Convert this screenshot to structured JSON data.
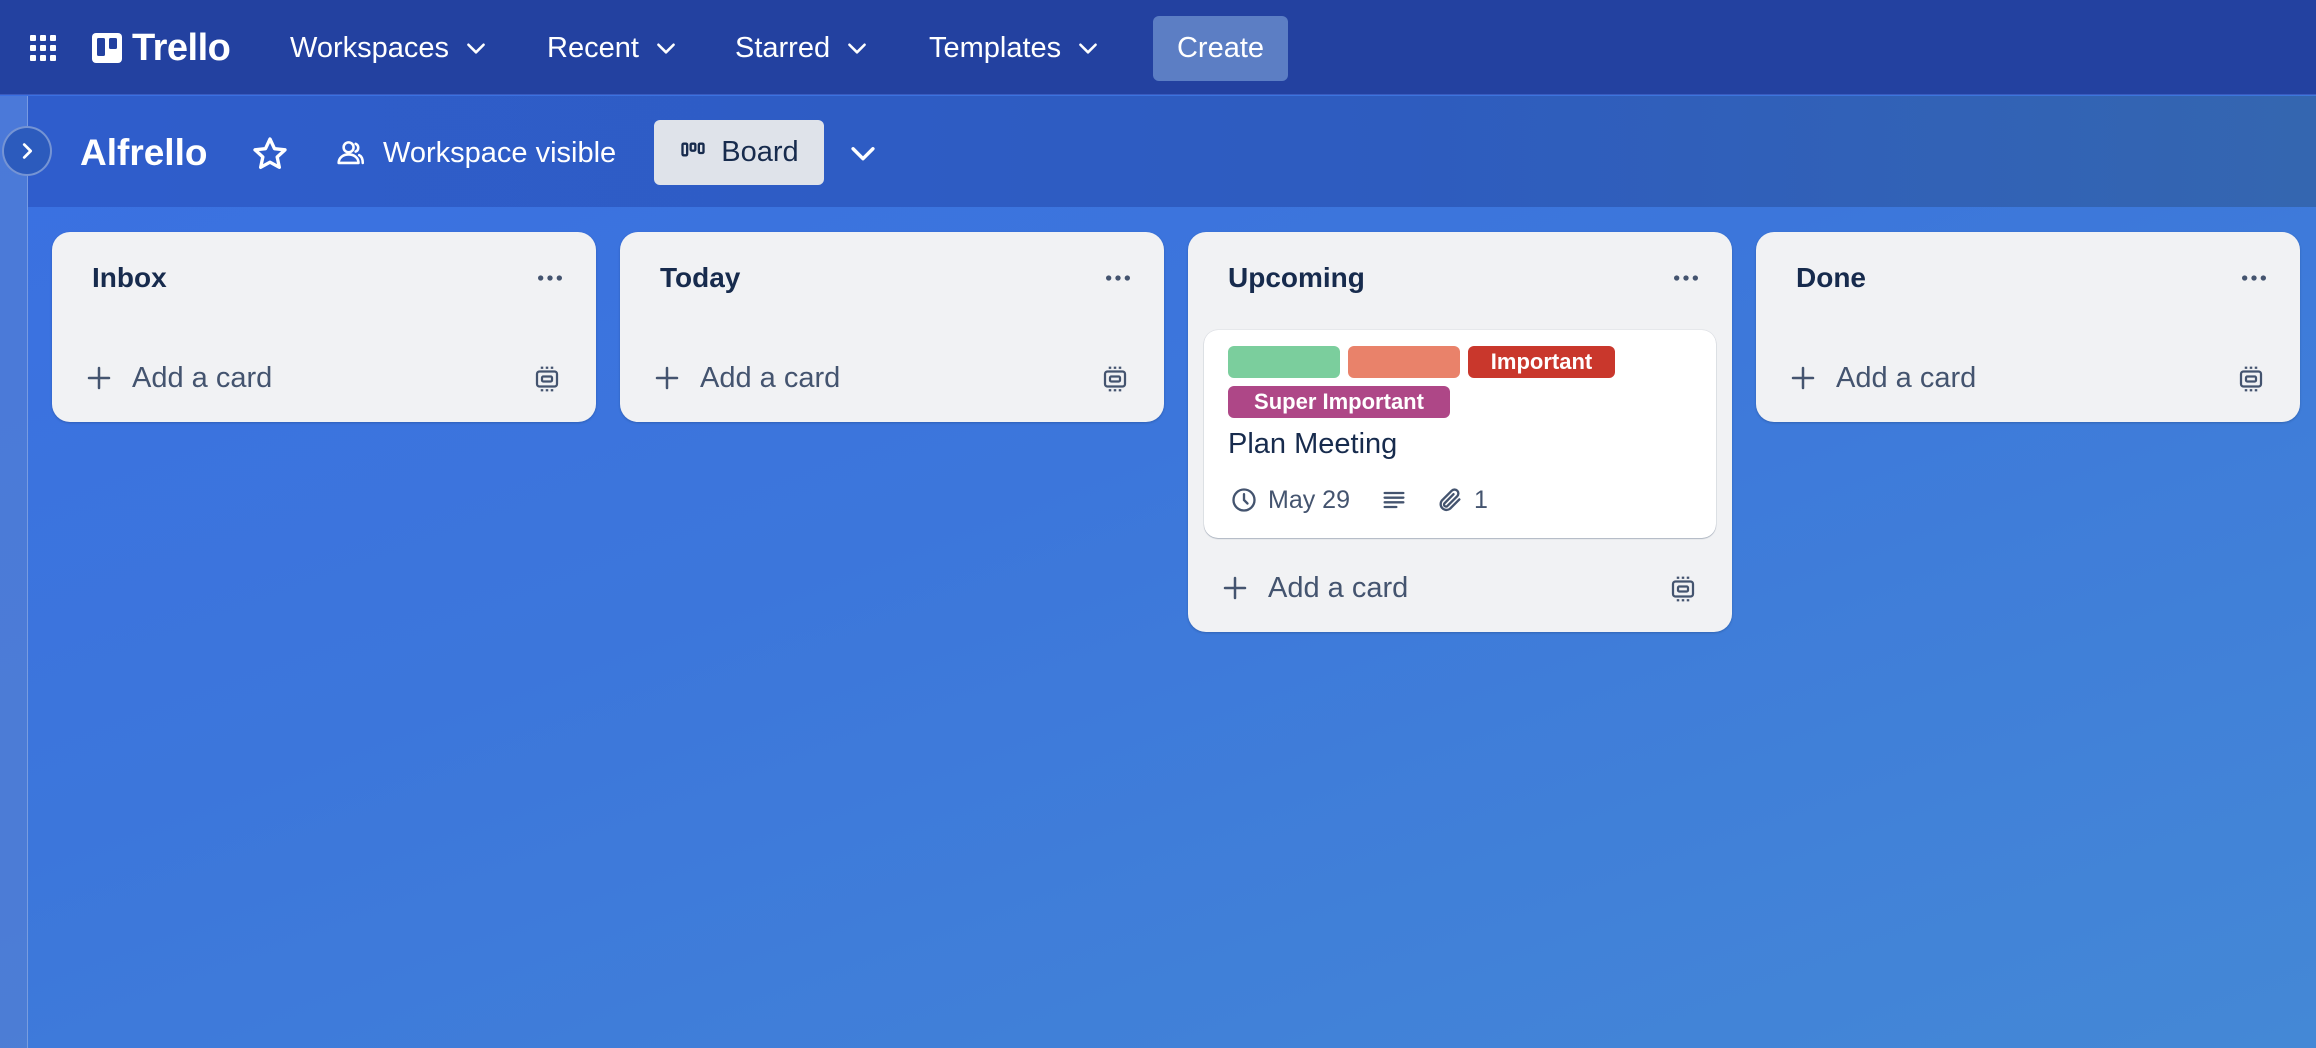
{
  "topnav": {
    "app_name": "Trello",
    "workspaces_label": "Workspaces",
    "recent_label": "Recent",
    "starred_label": "Starred",
    "templates_label": "Templates",
    "create_label": "Create"
  },
  "board": {
    "title": "Alfrello",
    "visibility_label": "Workspace visible",
    "view_label": "Board"
  },
  "lists": [
    {
      "title": "Inbox",
      "add_card_label": "Add a card"
    },
    {
      "title": "Today",
      "add_card_label": "Add a card"
    },
    {
      "title": "Upcoming",
      "add_card_label": "Add a card",
      "cards": [
        {
          "title": "Plan Meeting",
          "labels": [
            {
              "text": "",
              "color": "#7bce9d"
            },
            {
              "text": "",
              "color": "#e9826a"
            },
            {
              "text": "Important",
              "color": "#c9372c"
            },
            {
              "text": "Super Important",
              "color": "#ae4787"
            }
          ],
          "due_date": "May 29",
          "attachments": "1"
        }
      ]
    },
    {
      "title": "Done",
      "add_card_label": "Add a card"
    }
  ],
  "colors": {
    "topnav_bg": "#2341a0",
    "create_bg": "#5c7ec4",
    "list_bg": "#f1f2f4",
    "board_gradient_start": "#3a6fe3",
    "board_gradient_end": "#4488d6"
  }
}
